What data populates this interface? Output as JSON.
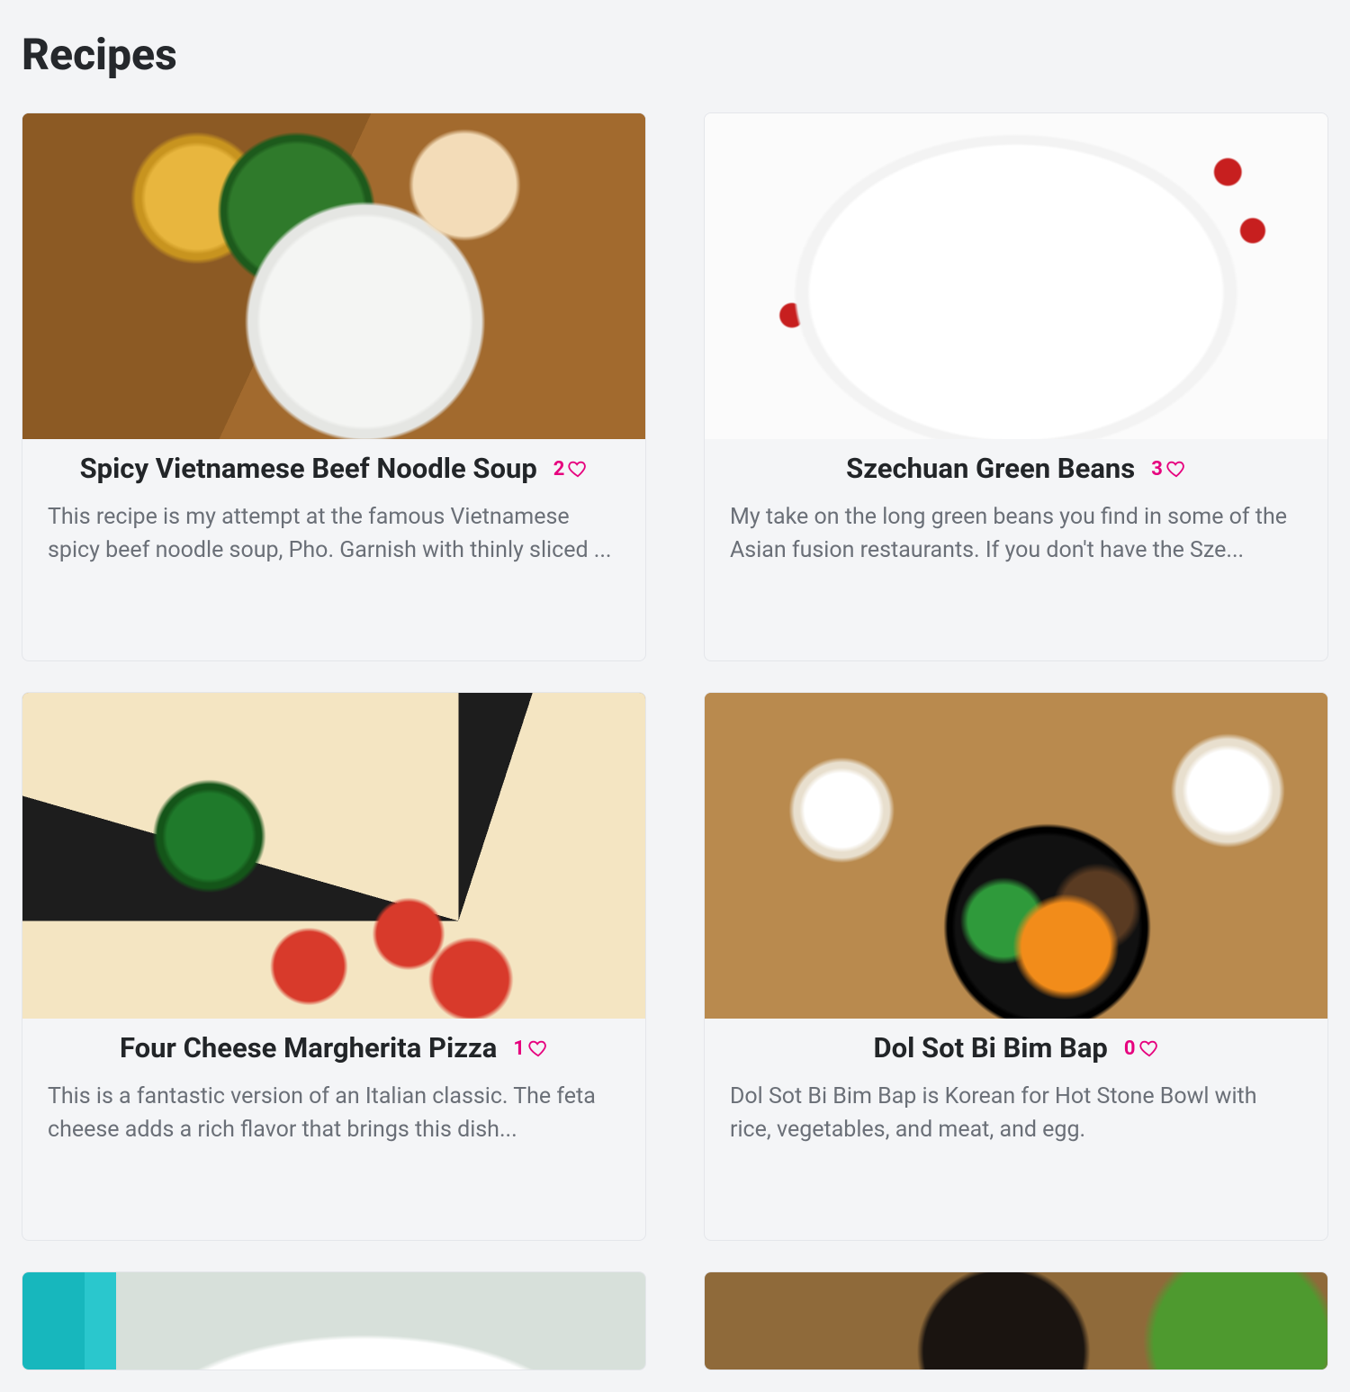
{
  "page": {
    "title": "Recipes"
  },
  "accent": "#e6007e",
  "recipes": [
    {
      "title": "Spicy Vietnamese Beef Noodle Soup",
      "likes": "2",
      "desc": "This recipe is my attempt at the famous Vietnamese spicy beef noodle soup, Pho. Garnish with thinly sliced ..."
    },
    {
      "title": "Szechuan Green Beans",
      "likes": "3",
      "desc": "My take on the long green beans you find in some of the Asian fusion restaurants. If you don't have the Sze..."
    },
    {
      "title": "Four Cheese Margherita Pizza",
      "likes": "1",
      "desc": "This is a fantastic version of an Italian classic. The feta cheese adds a rich flavor that brings this dish..."
    },
    {
      "title": "Dol Sot Bi Bim Bap",
      "likes": "0",
      "desc": "Dol Sot Bi Bim Bap is Korean for Hot Stone Bowl with rice, vegetables, and meat, and egg."
    }
  ]
}
